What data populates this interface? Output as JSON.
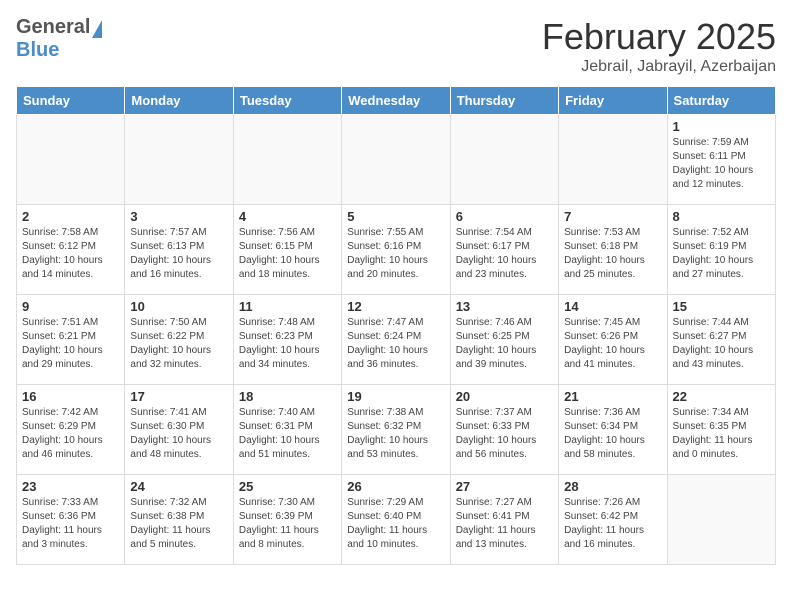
{
  "logo": {
    "general": "General",
    "blue": "Blue"
  },
  "title": "February 2025",
  "subtitle": "Jebrail, Jabrayil, Azerbaijan",
  "weekdays": [
    "Sunday",
    "Monday",
    "Tuesday",
    "Wednesday",
    "Thursday",
    "Friday",
    "Saturday"
  ],
  "weeks": [
    [
      {
        "day": "",
        "info": ""
      },
      {
        "day": "",
        "info": ""
      },
      {
        "day": "",
        "info": ""
      },
      {
        "day": "",
        "info": ""
      },
      {
        "day": "",
        "info": ""
      },
      {
        "day": "",
        "info": ""
      },
      {
        "day": "1",
        "info": "Sunrise: 7:59 AM\nSunset: 6:11 PM\nDaylight: 10 hours\nand 12 minutes."
      }
    ],
    [
      {
        "day": "2",
        "info": "Sunrise: 7:58 AM\nSunset: 6:12 PM\nDaylight: 10 hours\nand 14 minutes."
      },
      {
        "day": "3",
        "info": "Sunrise: 7:57 AM\nSunset: 6:13 PM\nDaylight: 10 hours\nand 16 minutes."
      },
      {
        "day": "4",
        "info": "Sunrise: 7:56 AM\nSunset: 6:15 PM\nDaylight: 10 hours\nand 18 minutes."
      },
      {
        "day": "5",
        "info": "Sunrise: 7:55 AM\nSunset: 6:16 PM\nDaylight: 10 hours\nand 20 minutes."
      },
      {
        "day": "6",
        "info": "Sunrise: 7:54 AM\nSunset: 6:17 PM\nDaylight: 10 hours\nand 23 minutes."
      },
      {
        "day": "7",
        "info": "Sunrise: 7:53 AM\nSunset: 6:18 PM\nDaylight: 10 hours\nand 25 minutes."
      },
      {
        "day": "8",
        "info": "Sunrise: 7:52 AM\nSunset: 6:19 PM\nDaylight: 10 hours\nand 27 minutes."
      }
    ],
    [
      {
        "day": "9",
        "info": "Sunrise: 7:51 AM\nSunset: 6:21 PM\nDaylight: 10 hours\nand 29 minutes."
      },
      {
        "day": "10",
        "info": "Sunrise: 7:50 AM\nSunset: 6:22 PM\nDaylight: 10 hours\nand 32 minutes."
      },
      {
        "day": "11",
        "info": "Sunrise: 7:48 AM\nSunset: 6:23 PM\nDaylight: 10 hours\nand 34 minutes."
      },
      {
        "day": "12",
        "info": "Sunrise: 7:47 AM\nSunset: 6:24 PM\nDaylight: 10 hours\nand 36 minutes."
      },
      {
        "day": "13",
        "info": "Sunrise: 7:46 AM\nSunset: 6:25 PM\nDaylight: 10 hours\nand 39 minutes."
      },
      {
        "day": "14",
        "info": "Sunrise: 7:45 AM\nSunset: 6:26 PM\nDaylight: 10 hours\nand 41 minutes."
      },
      {
        "day": "15",
        "info": "Sunrise: 7:44 AM\nSunset: 6:27 PM\nDaylight: 10 hours\nand 43 minutes."
      }
    ],
    [
      {
        "day": "16",
        "info": "Sunrise: 7:42 AM\nSunset: 6:29 PM\nDaylight: 10 hours\nand 46 minutes."
      },
      {
        "day": "17",
        "info": "Sunrise: 7:41 AM\nSunset: 6:30 PM\nDaylight: 10 hours\nand 48 minutes."
      },
      {
        "day": "18",
        "info": "Sunrise: 7:40 AM\nSunset: 6:31 PM\nDaylight: 10 hours\nand 51 minutes."
      },
      {
        "day": "19",
        "info": "Sunrise: 7:38 AM\nSunset: 6:32 PM\nDaylight: 10 hours\nand 53 minutes."
      },
      {
        "day": "20",
        "info": "Sunrise: 7:37 AM\nSunset: 6:33 PM\nDaylight: 10 hours\nand 56 minutes."
      },
      {
        "day": "21",
        "info": "Sunrise: 7:36 AM\nSunset: 6:34 PM\nDaylight: 10 hours\nand 58 minutes."
      },
      {
        "day": "22",
        "info": "Sunrise: 7:34 AM\nSunset: 6:35 PM\nDaylight: 11 hours\nand 0 minutes."
      }
    ],
    [
      {
        "day": "23",
        "info": "Sunrise: 7:33 AM\nSunset: 6:36 PM\nDaylight: 11 hours\nand 3 minutes."
      },
      {
        "day": "24",
        "info": "Sunrise: 7:32 AM\nSunset: 6:38 PM\nDaylight: 11 hours\nand 5 minutes."
      },
      {
        "day": "25",
        "info": "Sunrise: 7:30 AM\nSunset: 6:39 PM\nDaylight: 11 hours\nand 8 minutes."
      },
      {
        "day": "26",
        "info": "Sunrise: 7:29 AM\nSunset: 6:40 PM\nDaylight: 11 hours\nand 10 minutes."
      },
      {
        "day": "27",
        "info": "Sunrise: 7:27 AM\nSunset: 6:41 PM\nDaylight: 11 hours\nand 13 minutes."
      },
      {
        "day": "28",
        "info": "Sunrise: 7:26 AM\nSunset: 6:42 PM\nDaylight: 11 hours\nand 16 minutes."
      },
      {
        "day": "",
        "info": ""
      }
    ]
  ]
}
